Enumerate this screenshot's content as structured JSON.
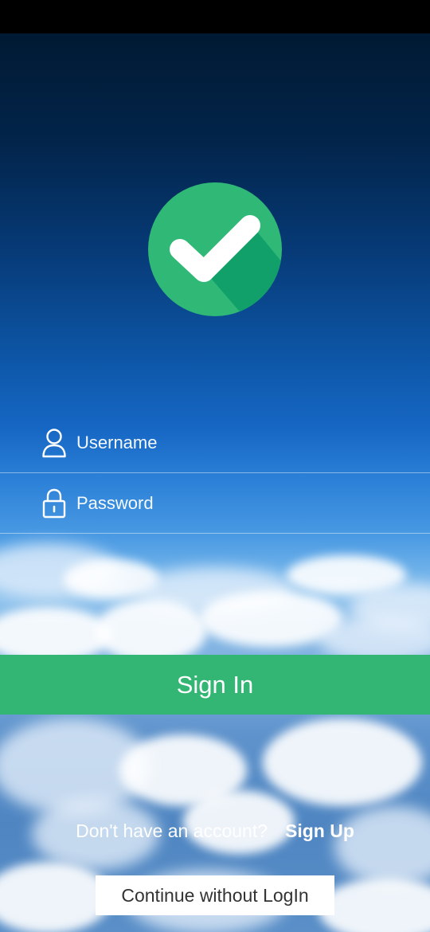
{
  "app": {
    "theme": {
      "accent": "#33b574",
      "check_circle": "#2fb876",
      "check_shadow": "#12a06a"
    }
  },
  "logo": {
    "icon": "check-circle-icon"
  },
  "form": {
    "username": {
      "placeholder": "Username",
      "icon": "user-icon"
    },
    "password": {
      "placeholder": "Password",
      "icon": "lock-icon"
    }
  },
  "actions": {
    "sign_in_label": "Sign In",
    "signup_prompt": "Don't have an account?",
    "signup_link": "Sign Up",
    "continue_label": "Continue without LogIn"
  }
}
